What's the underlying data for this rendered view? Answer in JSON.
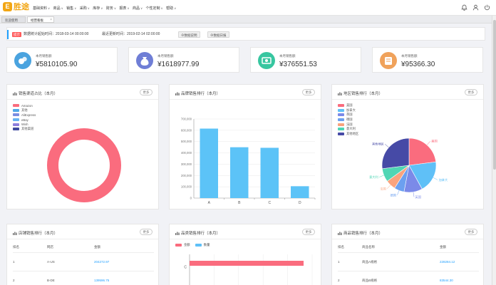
{
  "app": {
    "logo_mark": "E",
    "logo_text": "胜途"
  },
  "nav": {
    "items": [
      "基础资料",
      "商品",
      "销售",
      "采购",
      "库存",
      "财务",
      "报表",
      "商品",
      "个性定制",
      "帮助"
    ]
  },
  "tabs": [
    {
      "label": "欢迎使用"
    },
    {
      "label": "经营看板",
      "active": true,
      "close": "×"
    }
  ],
  "notice": {
    "badge": "提示",
    "start_text": "数据统计起始时间：2018-03-14 00:00:00",
    "end_text": "最近更新时间：2019-02-14 02:00:00",
    "btn_intro": "⊕数据说明",
    "btn_report": "⊕数据日报"
  },
  "stats": [
    {
      "label": "本月销售额",
      "value": "¥5810105.90",
      "color": "#4aa3df",
      "icon": "coins-icon"
    },
    {
      "label": "本月销售额",
      "value": "¥1618977.99",
      "color": "#6f7ed6",
      "icon": "money-bag-icon"
    },
    {
      "label": "本月销售额",
      "value": "¥376551.53",
      "color": "#37c6a0",
      "icon": "cash-icon"
    },
    {
      "label": "本月销售额",
      "value": "¥95366.30",
      "color": "#f0a25b",
      "icon": "wallet-icon"
    }
  ],
  "panels": {
    "channel": {
      "title": "销售渠道占比（本月）",
      "more": "更多",
      "legend": [
        {
          "name": "Amazon",
          "color": "#fa6c7e"
        },
        {
          "name": "其他",
          "color": "#4fa8e8"
        },
        {
          "name": "AliExpress",
          "color": "#7b8de0"
        },
        {
          "name": "eBay",
          "color": "#66b3f2"
        },
        {
          "name": "Wish",
          "color": "#8c7edb"
        },
        {
          "name": "其他渠道",
          "color": "#3e4a9e"
        }
      ]
    },
    "brand": {
      "title": "品牌销售排行（本月）",
      "more": "更多"
    },
    "region": {
      "title": "地区销售排行（本月）",
      "more": "更多",
      "legend": [
        {
          "name": "美国",
          "color": "#fa6c7e"
        },
        {
          "name": "加拿大",
          "color": "#5fc0f7"
        },
        {
          "name": "英国",
          "color": "#7b8ae8"
        },
        {
          "name": "德国",
          "color": "#6ca0f0"
        },
        {
          "name": "法国",
          "color": "#f9a37e"
        },
        {
          "name": "意大利",
          "color": "#4fd6b4"
        },
        {
          "name": "其他地区",
          "color": "#464aa6"
        }
      ],
      "slice_labels": [
        "美国",
        "加拿大",
        "英国",
        "德国",
        "法国",
        "意大利",
        "其他地区"
      ]
    },
    "store": {
      "title": "店铺销售排行（本月）",
      "more": "更多",
      "headers": [
        "排名",
        "网店",
        "金额"
      ],
      "rows": [
        [
          "1",
          "A-US",
          "204272.97"
        ],
        [
          "2",
          "B-DE",
          "139596.75"
        ]
      ]
    },
    "category": {
      "title": "品类销售排行（本月）",
      "more": "更多",
      "legend": [
        {
          "name": "金额",
          "color": "#fa6c7e"
        },
        {
          "name": "数量",
          "color": "#5fc0f7"
        }
      ]
    },
    "product": {
      "title": "商品销售排行（本月）",
      "more": "更多",
      "headers": [
        "排名",
        "商品名称",
        "金额"
      ],
      "rows": [
        [
          "1",
          "商品A规格",
          "228284.12"
        ],
        [
          "2",
          "商品B规格",
          "83544.30"
        ]
      ]
    }
  },
  "chart_data": [
    {
      "type": "pie",
      "chart": "channel",
      "categories": [
        "Amazon",
        "其他",
        "AliExpress",
        "eBay",
        "Wish",
        "其他渠道"
      ],
      "values": [
        100,
        0,
        0,
        0,
        0,
        0
      ]
    },
    {
      "type": "bar",
      "chart": "brand",
      "categories": [
        "A",
        "B",
        "C",
        "D"
      ],
      "values": [
        615000,
        450000,
        445000,
        105000
      ],
      "ylim": [
        0,
        700000
      ],
      "yticks": [
        "0",
        "100,000",
        "200,000",
        "300,000",
        "400,000",
        "500,000",
        "600,000",
        "700,000"
      ],
      "color": "#5cc3f7"
    },
    {
      "type": "pie",
      "chart": "region",
      "categories": [
        "美国",
        "加拿大",
        "英国",
        "德国",
        "法国",
        "意大利",
        "其他地区"
      ],
      "values": [
        23,
        19,
        11,
        6,
        6,
        8,
        27
      ]
    },
    {
      "type": "bar",
      "chart": "category",
      "categories": [
        "C"
      ],
      "series": [
        {
          "name": "金额",
          "values": [
            100
          ]
        },
        {
          "name": "数量",
          "values": [
            0
          ]
        }
      ]
    }
  ]
}
